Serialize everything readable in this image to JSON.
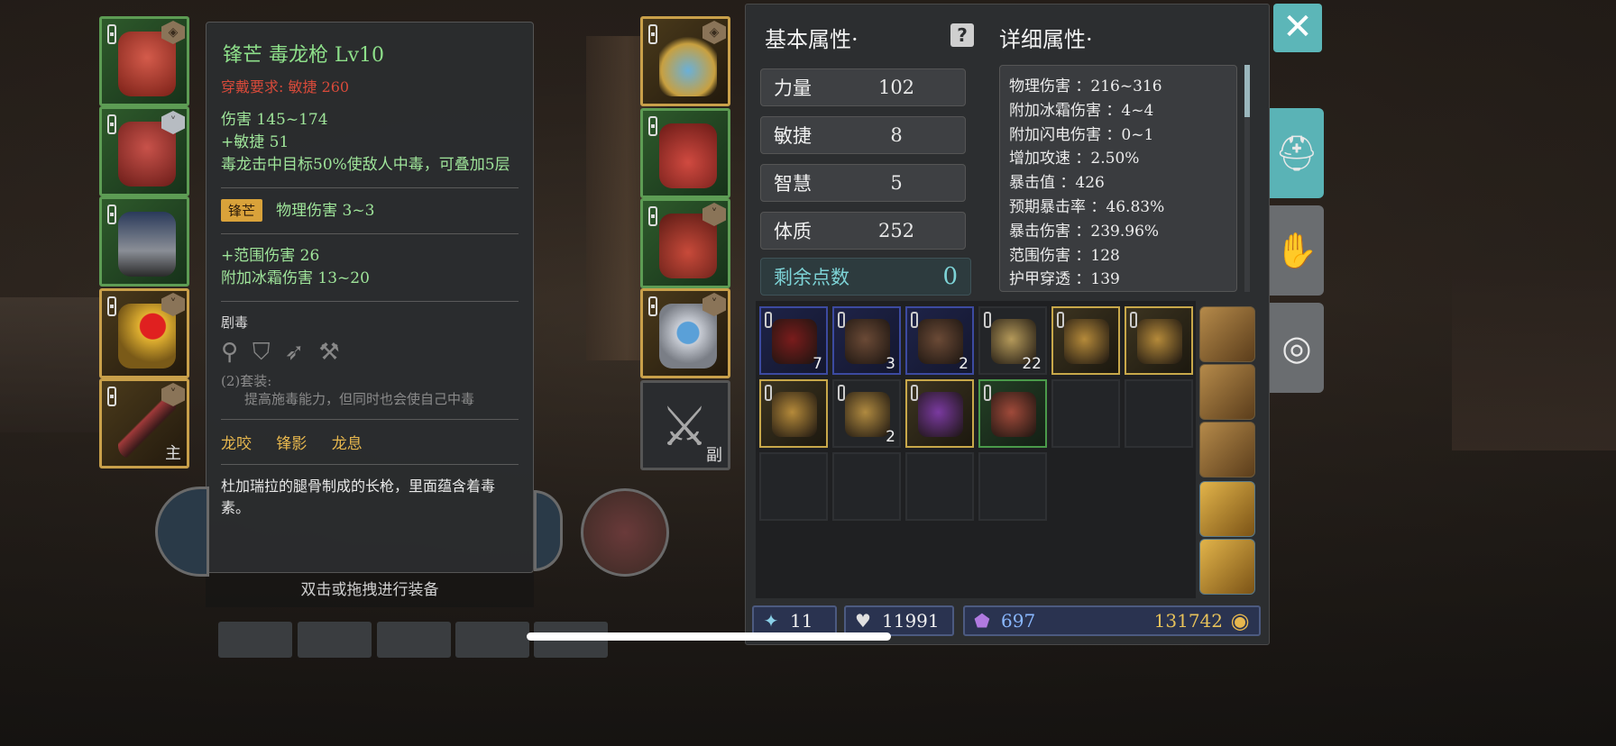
{
  "equipment_left": [
    {
      "slot": "helmet",
      "badge": "shield"
    },
    {
      "slot": "armor",
      "badge": "silver"
    },
    {
      "slot": "legs",
      "badge": ""
    },
    {
      "slot": "ring",
      "badge": "chevron"
    },
    {
      "slot": "weapon",
      "badge": "chevron",
      "tag": "主"
    }
  ],
  "equipment_right": [
    {
      "slot": "necklace",
      "badge": "shield"
    },
    {
      "slot": "gloves",
      "badge": ""
    },
    {
      "slot": "boots",
      "badge": "chevron"
    },
    {
      "slot": "ring2",
      "badge": "chevron"
    },
    {
      "slot": "offhand",
      "tag": "副"
    }
  ],
  "tooltip": {
    "title": "锋芒  毒龙枪  Lv10",
    "requirement": "穿戴要求:  敏捷 260",
    "base_lines": [
      "伤害   145~174",
      "+敏捷  51",
      "毒龙击中目标50%使敌人中毒，可叠加5层"
    ],
    "prefix_pill": "锋芒",
    "prefix_text": "物理伤害  3~3",
    "extra_lines": [
      "+范围伤害  26",
      "附加冰霜伤害  13~20"
    ],
    "set_name": "剧毒",
    "set_icons": [
      "necklace-icon",
      "shield-icon",
      "spear-icon",
      "axe-icon"
    ],
    "set_bonus_label": "(2)套装:",
    "set_bonus_text": "提高施毒能力，但同时也会使自己中毒",
    "links": "龙咬 锋影 龙息",
    "description": "杜加瑞拉的腿骨制成的长枪，里面蕴含着毒素。"
  },
  "hint": "双击或拖拽进行装备",
  "basic_title": "基本属性·",
  "detail_title": "详细属性·",
  "attributes": [
    {
      "label": "力量",
      "value": "102"
    },
    {
      "label": "敏捷",
      "value": "8"
    },
    {
      "label": "智慧",
      "value": "5"
    },
    {
      "label": "体质",
      "value": "252"
    }
  ],
  "remaining": {
    "label": "剩余点数",
    "value": "0"
  },
  "details": [
    "物理伤害 ：216~316",
    "附加冰霜伤害 ：4~4",
    "附加闪电伤害 ：0~1",
    "增加攻速 ：2.50%",
    "暴击值 ：426",
    "预期暴击率 ：46.83%",
    "暴击伤害 ：239.96%",
    "范围伤害 ：128",
    "护甲穿透 ：139"
  ],
  "inventory": [
    {
      "rarity": "blue",
      "count": "7",
      "color": "#7a1c1c"
    },
    {
      "rarity": "blue",
      "count": "3",
      "color": "#6b4a36"
    },
    {
      "rarity": "blue",
      "count": "2",
      "color": "#6b4a36"
    },
    {
      "rarity": "dk",
      "count": "22",
      "color": "#b59a5a"
    },
    {
      "rarity": "gold",
      "count": "",
      "color": "#b58a3a"
    },
    {
      "rarity": "gold",
      "count": "",
      "color": "#b58a3a"
    },
    {
      "rarity": "gold",
      "count": "",
      "color": "#b58a3a"
    },
    {
      "rarity": "dk",
      "count": "2",
      "color": "#b08a40"
    },
    {
      "rarity": "gold",
      "count": "",
      "color": "#7a3aa0"
    },
    {
      "rarity": "green",
      "count": "",
      "color": "#a04a3a"
    },
    {
      "rarity": "dk",
      "count": "",
      "color": ""
    },
    {
      "rarity": "dk",
      "count": "",
      "color": ""
    },
    {
      "rarity": "dk",
      "count": "",
      "color": ""
    },
    {
      "rarity": "dk",
      "count": "",
      "color": ""
    },
    {
      "rarity": "dk",
      "count": "",
      "color": ""
    },
    {
      "rarity": "dk",
      "count": "",
      "color": ""
    }
  ],
  "currency": {
    "gems": "11",
    "crystals": "11991",
    "purple": "697",
    "gold": "131742"
  },
  "close_label": "✕",
  "colors": {
    "accent": "#5ab3b6",
    "green_text": "#9fe59a",
    "red_text": "#d84a3a",
    "gold_text": "#e7b74e"
  }
}
